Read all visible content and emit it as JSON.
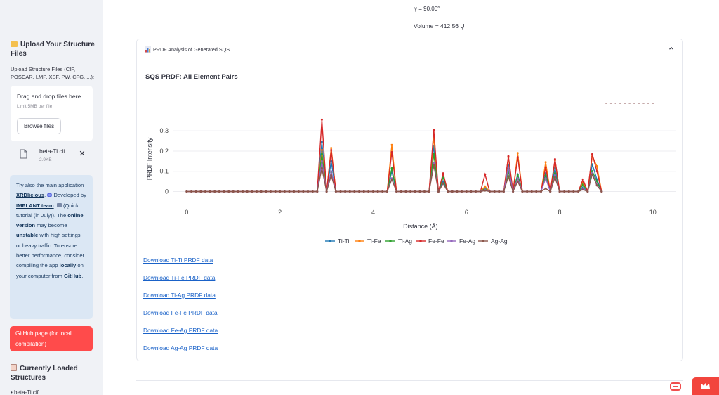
{
  "sidebar": {
    "upload_heading": "Upload Your Structure Files",
    "upload_label": "Upload Structure Files (CIF, POSCAR, LMP, XSF, PW, CFG, ...):",
    "dropzone": {
      "title": "Drag and drop files here",
      "limit": "Limit 5MB per file",
      "browse_label": "Browse files"
    },
    "file": {
      "name": "beta-Ti.cif",
      "size": "2.9KB"
    },
    "info": {
      "t1": "Try also the main application ",
      "link1": "XRDlicious",
      "t2": ". ",
      "t3": " Developed by ",
      "link2": "IMPLANT team",
      "t4": ". ",
      "t5": " (Quick tutorial (in July)). The ",
      "b1": "online version",
      "t6": " may become ",
      "b2": "unstable",
      "t7": " with high settings or heavy traffic. To ensure better performance, consider compiling the app ",
      "b3": "locally",
      "t8": " on your computer from ",
      "b4": "GitHub",
      "t9": "."
    },
    "github_button": "GitHub page (for local compilation)",
    "loaded_heading": "Currently Loaded Structures",
    "loaded_item": "• beta-Ti.cif"
  },
  "main": {
    "gamma_text": "γ = 90.00°",
    "volume_text": "Volume = 412.56 Ų",
    "expander_title": "PRDF Analysis of Generated SQS",
    "chart_title": "SQS PRDF: All Element Pairs",
    "downloads": [
      "Download Ti-Ti PRDF data",
      "Download Ti-Fe PRDF data",
      "Download Ti-Ag PRDF data",
      "Download Fe-Fe PRDF data",
      "Download Fe-Ag PRDF data",
      "Download Ag-Ag PRDF data"
    ]
  },
  "colors": {
    "sidebar_bg": "#f0f2f6",
    "info_bg": "#dbe7f4",
    "accent_red": "#ff4b4b",
    "link": "#1a62c8"
  },
  "chart_data": {
    "type": "line",
    "title": "",
    "xlabel": "Distance (Å)",
    "ylabel": "PRDF Intensity",
    "xlim": [
      -0.3,
      10.5
    ],
    "ylim": [
      -0.012,
      0.37
    ],
    "xticks": [
      0,
      2,
      4,
      6,
      8,
      10
    ],
    "yticks": [
      0,
      0.1,
      0.2,
      0.3
    ],
    "grid": true,
    "legend_position": "bottom",
    "x": [
      0,
      0.1,
      0.2,
      0.3,
      0.4,
      0.5,
      0.6,
      0.7,
      0.8,
      0.9,
      1.0,
      1.1,
      1.2,
      1.3,
      1.4,
      1.5,
      1.6,
      1.7,
      1.8,
      1.9,
      2.0,
      2.1,
      2.2,
      2.3,
      2.4,
      2.5,
      2.6,
      2.7,
      2.8,
      2.9,
      3.0,
      3.1,
      3.2,
      3.3,
      3.4,
      3.5,
      3.6,
      3.7,
      3.8,
      3.9,
      4.0,
      4.1,
      4.2,
      4.3,
      4.4,
      4.5,
      4.6,
      4.7,
      4.8,
      4.9,
      5.0,
      5.1,
      5.2,
      5.3,
      5.4,
      5.5,
      5.6,
      5.7,
      5.8,
      5.9,
      6.0,
      6.1,
      6.2,
      6.3,
      6.4,
      6.5,
      6.6,
      6.7,
      6.8,
      6.9,
      7.0,
      7.1,
      7.2,
      7.3,
      7.4,
      7.5,
      7.6,
      7.7,
      7.8,
      7.9,
      8.0,
      8.1,
      8.2,
      8.3,
      8.4,
      8.5,
      8.6,
      8.7,
      8.8,
      8.9,
      9.0,
      9.1,
      9.2,
      9.3,
      9.4,
      9.5,
      9.6,
      9.7,
      9.8,
      9.9,
      10.0
    ],
    "series": [
      {
        "name": "Ti-Ti",
        "color": "#1f77b4",
        "values": [
          0,
          0,
          0,
          0,
          0,
          0,
          0,
          0,
          0,
          0,
          0,
          0,
          0,
          0,
          0,
          0,
          0,
          0,
          0,
          0,
          0,
          0,
          0,
          0,
          0,
          0,
          0,
          0,
          0,
          0.245,
          0,
          0.15,
          0,
          0,
          0,
          0,
          0,
          0,
          0,
          0,
          0,
          0,
          0,
          0,
          0.1,
          0,
          0,
          0,
          0,
          0,
          0,
          0,
          0,
          0.225,
          0,
          0.05,
          0,
          0,
          0,
          0,
          0,
          0,
          0,
          0,
          0.015,
          0,
          0,
          0,
          0,
          0.13,
          0,
          0.085,
          0,
          0,
          0,
          0,
          0,
          0.09,
          0,
          0.115,
          0,
          0,
          0,
          0,
          0,
          0.02,
          0,
          0.135,
          0.06,
          0
        ]
      },
      {
        "name": "Ti-Fe",
        "color": "#ff7f0e",
        "values": [
          0,
          0,
          0,
          0,
          0,
          0,
          0,
          0,
          0,
          0,
          0,
          0,
          0,
          0,
          0,
          0,
          0,
          0,
          0,
          0,
          0,
          0,
          0,
          0,
          0,
          0,
          0,
          0,
          0,
          0.205,
          0,
          0.215,
          0,
          0,
          0,
          0,
          0,
          0,
          0,
          0,
          0,
          0,
          0,
          0,
          0.23,
          0,
          0,
          0,
          0,
          0,
          0,
          0,
          0,
          0.27,
          0,
          0.08,
          0,
          0,
          0,
          0,
          0,
          0,
          0,
          0,
          0.025,
          0,
          0,
          0,
          0,
          0.17,
          0,
          0.19,
          0,
          0,
          0,
          0,
          0,
          0.145,
          0,
          0.155,
          0,
          0,
          0,
          0,
          0,
          0.045,
          0,
          0.175,
          0.125,
          0
        ]
      },
      {
        "name": "Ti-Ag",
        "color": "#2ca02c",
        "values": [
          0,
          0,
          0,
          0,
          0,
          0,
          0,
          0,
          0,
          0,
          0,
          0,
          0,
          0,
          0,
          0,
          0,
          0,
          0,
          0,
          0,
          0,
          0,
          0,
          0,
          0,
          0,
          0,
          0,
          0.185,
          0,
          0.095,
          0,
          0,
          0,
          0,
          0,
          0,
          0,
          0,
          0,
          0,
          0,
          0,
          0.115,
          0,
          0,
          0,
          0,
          0,
          0,
          0,
          0,
          0.185,
          0,
          0.07,
          0,
          0,
          0,
          0,
          0,
          0,
          0,
          0,
          0.015,
          0,
          0,
          0,
          0,
          0.1,
          0,
          0.08,
          0,
          0,
          0,
          0,
          0,
          0.08,
          0,
          0.09,
          0,
          0,
          0,
          0,
          0,
          0.035,
          0,
          0.1,
          0.05,
          0
        ]
      },
      {
        "name": "Fe-Fe",
        "color": "#d62728",
        "values": [
          0,
          0,
          0,
          0,
          0,
          0,
          0,
          0,
          0,
          0,
          0,
          0,
          0,
          0,
          0,
          0,
          0,
          0,
          0,
          0,
          0,
          0,
          0,
          0,
          0,
          0,
          0,
          0,
          0,
          0.355,
          0,
          0.205,
          0,
          0,
          0,
          0,
          0,
          0,
          0,
          0,
          0,
          0,
          0,
          0,
          0.195,
          0,
          0,
          0,
          0,
          0,
          0,
          0,
          0,
          0.305,
          0,
          0.09,
          0,
          0,
          0,
          0,
          0,
          0,
          0,
          0,
          0.085,
          0,
          0,
          0,
          0,
          0.175,
          0,
          0.17,
          0,
          0,
          0,
          0,
          0,
          0.12,
          0,
          0.16,
          0,
          0,
          0,
          0,
          0,
          0.06,
          0,
          0.185,
          0.1,
          0
        ]
      },
      {
        "name": "Fe-Ag",
        "color": "#9467bd",
        "values": [
          0,
          0,
          0,
          0,
          0,
          0,
          0,
          0,
          0,
          0,
          0,
          0,
          0,
          0,
          0,
          0,
          0,
          0,
          0,
          0,
          0,
          0,
          0,
          0,
          0,
          0,
          0,
          0,
          0,
          0.15,
          0,
          0.1,
          0,
          0,
          0,
          0,
          0,
          0,
          0,
          0,
          0,
          0,
          0,
          0,
          0.065,
          0,
          0,
          0,
          0,
          0,
          0,
          0,
          0,
          0.14,
          0,
          0.04,
          0,
          0,
          0,
          0,
          0,
          0,
          0,
          0,
          0.01,
          0,
          0,
          0,
          0,
          0.12,
          0,
          0.065,
          0,
          0,
          0,
          0,
          0,
          0.065,
          0,
          0.08,
          0,
          0,
          0,
          0,
          0,
          0.015,
          0,
          0.09,
          0.035,
          0
        ]
      },
      {
        "name": "Ag-Ag",
        "color": "#8c564b",
        "values": [
          0,
          0,
          0,
          0,
          0,
          0,
          0,
          0,
          0,
          0,
          0,
          0,
          0,
          0,
          0,
          0,
          0,
          0,
          0,
          0,
          0,
          0,
          0,
          0,
          0,
          0,
          0,
          0,
          0,
          0.115,
          0,
          0.08,
          0,
          0,
          0,
          0,
          0,
          0,
          0,
          0,
          0,
          0,
          0,
          0,
          0.06,
          0,
          0,
          0,
          0,
          0,
          0,
          0,
          0,
          0.13,
          0,
          0.04,
          0,
          0,
          0,
          0,
          0,
          0,
          0,
          0,
          0.005,
          0,
          0,
          0,
          0,
          0.075,
          0,
          0.05,
          0,
          0,
          0,
          0,
          0,
          0.015,
          0,
          0.07,
          0,
          0,
          0,
          0,
          0,
          0.01,
          0,
          0.085,
          0.03,
          0
        ]
      }
    ]
  }
}
